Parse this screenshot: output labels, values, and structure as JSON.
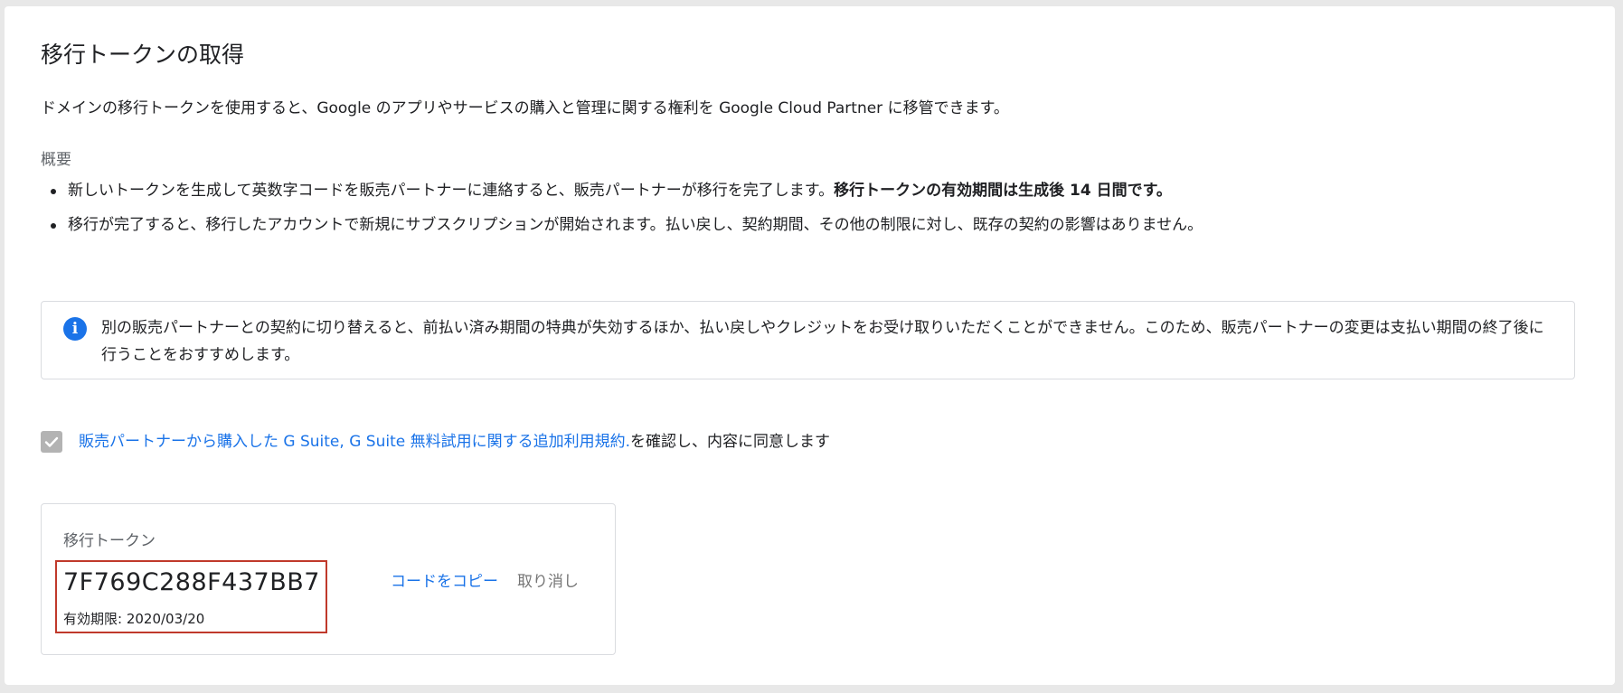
{
  "page": {
    "title": "移行トークンの取得",
    "intro": "ドメインの移行トークンを使用すると、Google のアプリやサービスの購入と管理に関する権利を Google Cloud Partner に移管できます。"
  },
  "overview": {
    "heading": "概要",
    "bullet1_text": "新しいトークンを生成して英数字コードを販売パートナーに連絡すると、販売パートナーが移行を完了します。",
    "bullet1_bold": "移行トークンの有効期間は生成後 14 日間です。",
    "bullet2_text": "移行が完了すると、移行したアカウントで新規にサブスクリプションが開始されます。払い戻し、契約期間、その他の制限に対し、既存の契約の影響はありません。"
  },
  "info": {
    "text": "別の販売パートナーとの契約に切り替えると、前払い済み期間の特典が失効するほか、払い戻しやクレジットをお受け取りいただくことができません。このため、販売パートナーの変更は支払い期間の終了後に行うことをおすすめします。"
  },
  "agreement": {
    "checked": true,
    "link_text": "販売パートナーから購入した G Suite, G Suite 無料試用に関する追加利用規約.",
    "suffix": "を確認し、内容に同意します"
  },
  "token": {
    "label": "移行トークン",
    "code": "7F769C288F437BB7",
    "expiry": "有効期限: 2020/03/20",
    "copy_label": "コードをコピー",
    "cancel_label": "取り消し"
  },
  "colors": {
    "link": "#1a73e8",
    "info_icon": "#1a73e8",
    "highlight_border": "#c0392b",
    "checkbox_fill": "#b3b3b3"
  },
  "icons": {
    "info": "info-icon",
    "checkbox": "check-icon"
  }
}
